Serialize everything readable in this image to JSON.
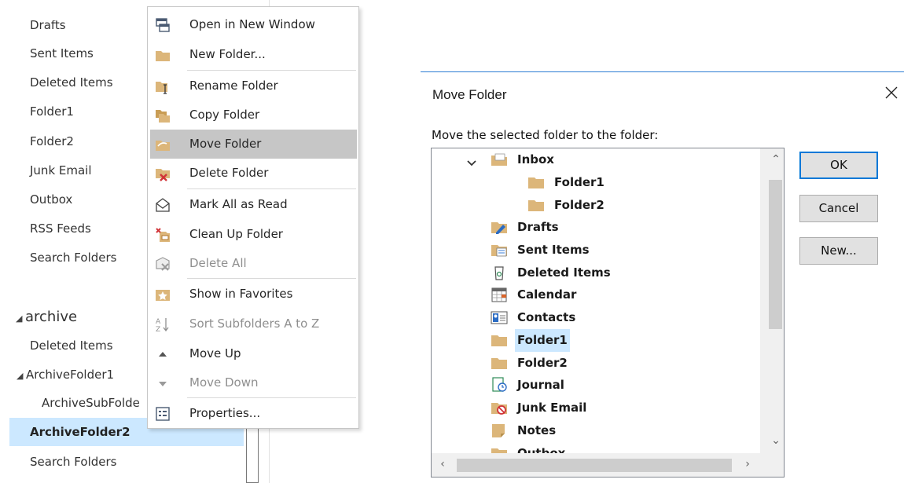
{
  "folder_pane": {
    "items": [
      {
        "label": "Drafts"
      },
      {
        "label": "Sent Items"
      },
      {
        "label": "Deleted Items"
      },
      {
        "label": "Folder1"
      },
      {
        "label": "Folder2"
      },
      {
        "label": "Junk Email"
      },
      {
        "label": "Outbox"
      },
      {
        "label": "RSS Feeds"
      },
      {
        "label": "Search Folders"
      }
    ],
    "archive": {
      "label": "archive",
      "items": [
        {
          "label": "Deleted Items"
        },
        {
          "label": "ArchiveFolder1"
        },
        {
          "label": "ArchiveSubFolde"
        },
        {
          "label": "ArchiveFolder2",
          "selected": true
        },
        {
          "label": "Search Folders"
        }
      ]
    },
    "colors": {
      "selected_bg": "#cce8ff"
    }
  },
  "context_menu": {
    "items": [
      {
        "label": "Open in New Window",
        "icon": "new-window-icon"
      },
      {
        "label": "New Folder...",
        "icon": "folder-icon"
      },
      {
        "label": "Rename Folder",
        "icon": "rename-folder-icon"
      },
      {
        "label": "Copy Folder",
        "icon": "copy-folder-icon"
      },
      {
        "label": "Move Folder",
        "icon": "move-folder-icon",
        "highlighted": true
      },
      {
        "label": "Delete Folder",
        "icon": "delete-folder-icon"
      },
      {
        "label": "Mark All as Read",
        "icon": "open-envelope-icon"
      },
      {
        "label": "Clean Up Folder",
        "icon": "clean-up-icon"
      },
      {
        "label": "Delete All",
        "icon": "delete-all-icon",
        "disabled": true
      },
      {
        "label": "Show in Favorites",
        "icon": "star-folder-icon"
      },
      {
        "label": "Sort Subfolders A to Z",
        "icon": "sort-az-icon",
        "disabled": true
      },
      {
        "label": "Move Up",
        "icon": "triangle-up-icon"
      },
      {
        "label": "Move Down",
        "icon": "triangle-down-icon",
        "disabled": true
      },
      {
        "label": "Properties...",
        "icon": "properties-icon"
      }
    ],
    "colors": {
      "highlight_bg": "#c6c6c6",
      "disabled_text": "#8f8f8f"
    }
  },
  "dialog": {
    "title": "Move Folder",
    "prompt": "Move the selected folder to the folder:",
    "tree": [
      {
        "label": "Inbox",
        "icon": "inbox-folder-icon",
        "expanded": true
      },
      {
        "label": "Folder1",
        "icon": "folder-icon"
      },
      {
        "label": "Folder2",
        "icon": "folder-icon"
      },
      {
        "label": "Drafts",
        "icon": "drafts-folder-icon"
      },
      {
        "label": "Sent Items",
        "icon": "sent-items-icon"
      },
      {
        "label": "Deleted Items",
        "icon": "recycle-bin-icon"
      },
      {
        "label": "Calendar",
        "icon": "calendar-icon"
      },
      {
        "label": "Contacts",
        "icon": "contacts-icon"
      },
      {
        "label": "Folder1",
        "icon": "folder-icon",
        "selected": true
      },
      {
        "label": "Folder2",
        "icon": "folder-icon"
      },
      {
        "label": "Journal",
        "icon": "journal-icon"
      },
      {
        "label": "Junk Email",
        "icon": "junk-email-icon"
      },
      {
        "label": "Notes",
        "icon": "notes-icon"
      },
      {
        "label": "Outbox",
        "icon": "folder-icon"
      }
    ],
    "buttons": {
      "ok": "OK",
      "cancel": "Cancel",
      "new": "New..."
    },
    "colors": {
      "accent": "#0078d7",
      "title_line": "#2b7cd3",
      "folder": "#dcb67a"
    }
  }
}
